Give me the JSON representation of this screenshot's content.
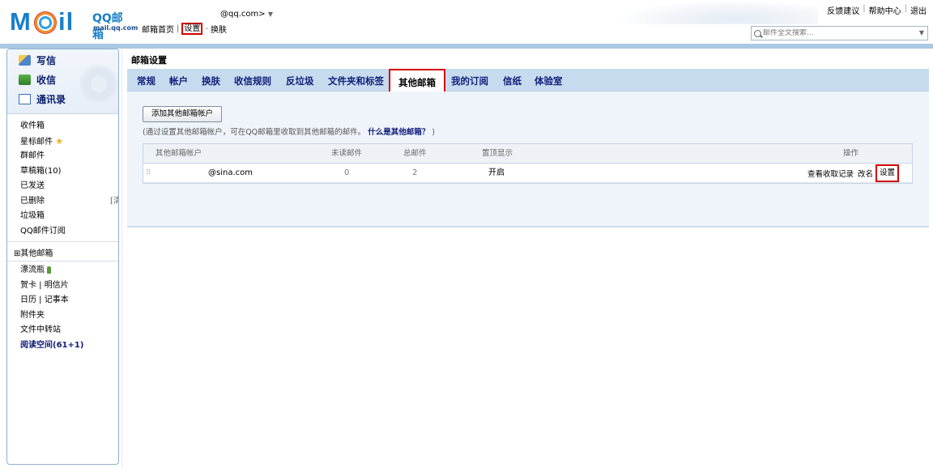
{
  "header": {
    "logo": {
      "wordmark": "MOil",
      "brand": "QQ邮箱",
      "url": "mail.qq.com"
    },
    "account": {
      "email": "@qq.com>",
      "arrow": "▼"
    },
    "nav": {
      "home": "邮箱首页",
      "sep": "|",
      "settings": "设置",
      "dash": "-",
      "skin": "换肤"
    },
    "links": [
      "反馈建议",
      "帮助中心",
      "退出"
    ],
    "search": {
      "placeholder": "邮件全文搜索...",
      "icon": "search-icon"
    }
  },
  "sidebar": {
    "main": [
      {
        "label": "写信",
        "icon": "compose-icon"
      },
      {
        "label": "收信",
        "icon": "receive-icon"
      },
      {
        "label": "通讯录",
        "icon": "contacts-icon"
      }
    ],
    "folders": [
      {
        "label": "收件箱"
      },
      {
        "label": "星标邮件",
        "icon": "star-icon",
        "star": "★"
      },
      {
        "label": "群邮件"
      },
      {
        "label": "草稿箱(10)"
      },
      {
        "label": "已发送"
      },
      {
        "label": "已删除",
        "action": "[清空]"
      },
      {
        "label": "垃圾箱"
      },
      {
        "label": "QQ邮件订阅"
      }
    ],
    "other_mailbox": "⊞其他邮箱",
    "tools": [
      {
        "label": "漂流瓶"
      },
      {
        "label": "贺卡  |  明信片"
      },
      {
        "label": "日历  |  记事本"
      },
      {
        "label": "附件夹"
      },
      {
        "label": "文件中转站"
      },
      {
        "label": "阅读空间(61+1)"
      }
    ]
  },
  "main": {
    "title": "邮箱设置",
    "tabs": [
      "常规",
      "帐户",
      "换肤",
      "收信规则",
      "反垃圾",
      "文件夹和标签",
      "其他邮箱",
      "我的订阅",
      "信纸",
      "体验室"
    ],
    "active_tab": "其他邮箱",
    "add_button": "添加其他邮箱帐户",
    "hint": "(通过设置其他邮箱帐户，可在QQ邮箱里收取到其他邮箱的邮件。",
    "hint_link": "什么是其他邮箱？",
    "hint_end": ")",
    "table": {
      "headers": [
        "其他邮箱帐户",
        "未读邮件",
        "总邮件",
        "置顶显示",
        "操作"
      ],
      "rows": [
        {
          "grip": "⠿",
          "account": "@sina.com",
          "unread": "0",
          "total": "2",
          "pinned": "开启",
          "ops": [
            "查看收取记录",
            "改名",
            "设置"
          ]
        }
      ]
    }
  }
}
